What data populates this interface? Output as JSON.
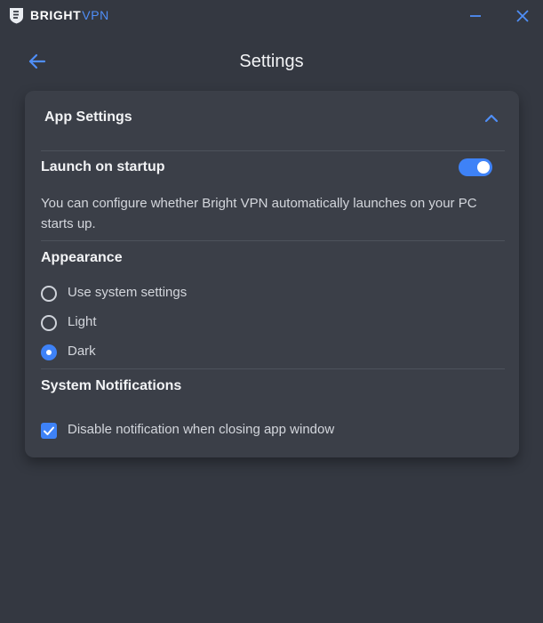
{
  "app": {
    "brand_part1": "BRIGHT",
    "brand_part2": "VPN"
  },
  "window_controls": {
    "minimize_icon": "minimize-icon",
    "close_icon": "close-icon"
  },
  "header": {
    "title": "Settings",
    "back_icon": "arrow-left-icon"
  },
  "settings_card": {
    "title": "App Settings",
    "expanded": true,
    "launch_on_startup": {
      "label": "Launch on startup",
      "enabled": true,
      "description": "You can configure whether Bright VPN automatically launches on your PC starts up."
    },
    "appearance": {
      "title": "Appearance",
      "options": [
        {
          "label": "Use system settings",
          "selected": false
        },
        {
          "label": "Light",
          "selected": false
        },
        {
          "label": "Dark",
          "selected": true
        }
      ]
    },
    "system_notifications": {
      "title": "System Notifications",
      "disable_on_close": {
        "label": "Disable notification when closing app window",
        "checked": true
      }
    }
  },
  "colors": {
    "background": "#343841",
    "card": "#3b3f48",
    "accent": "#3e82f7",
    "brand_accent": "#4f8ef7"
  }
}
